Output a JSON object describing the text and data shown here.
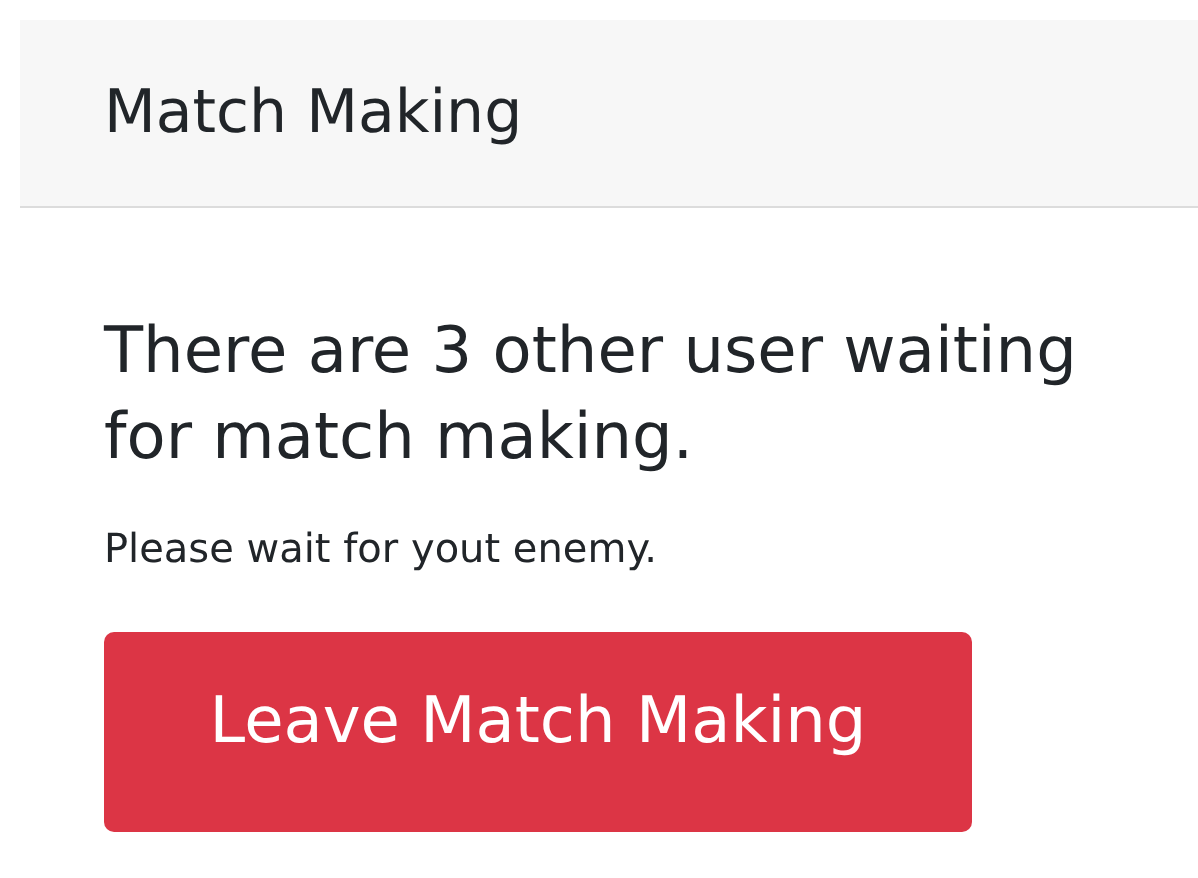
{
  "card": {
    "title": "Match Making",
    "message": "There are 3 other user waiting for match making.",
    "note": "Please wait for yout enemy.",
    "button": "Leave Match Making"
  }
}
